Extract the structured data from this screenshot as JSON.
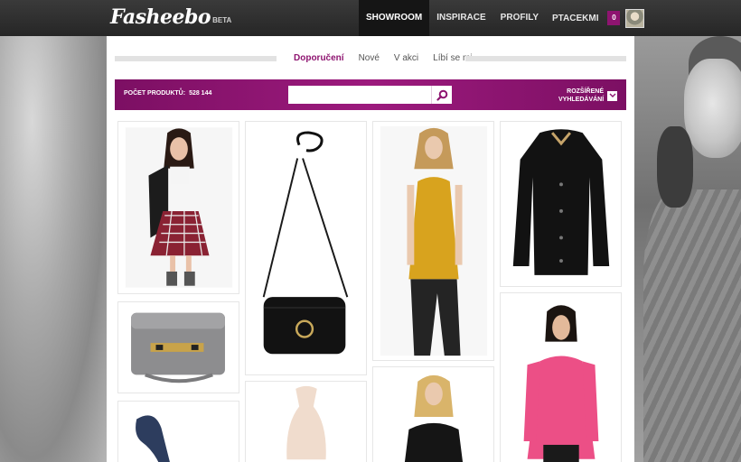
{
  "header": {
    "logo": "Fasheebo",
    "beta": "BETA",
    "nav": [
      "SHOWROOM",
      "INSPIRACE",
      "PROFILY"
    ],
    "active_nav": "SHOWROOM",
    "username": "PTACEKMI",
    "badge_count": "0"
  },
  "tabs": {
    "items": [
      "Doporučení",
      "Nové",
      "V akci",
      "Líbí se mi"
    ],
    "active": "Doporučení"
  },
  "search": {
    "count_label": "POČET PRODUKTŮ:",
    "count_value": "528 144",
    "placeholder": "",
    "advanced_label_1": "ROZŠÍŘENÉ",
    "advanced_label_2": "VYHLEDÁVÁNÍ"
  },
  "products": [
    {
      "name": "plaid skirt outfit with leather jacket",
      "column": 1
    },
    {
      "name": "grey leather satchel bag",
      "column": 1
    },
    {
      "name": "navy suede pump",
      "column": 1
    },
    {
      "name": "black crossbody bag with gold logo",
      "column": 2
    },
    {
      "name": "cream halter top",
      "column": 2
    },
    {
      "name": "mustard tank top with black jeans",
      "column": 3
    },
    {
      "name": "black lace top",
      "column": 3
    },
    {
      "name": "black quilted jacket",
      "column": 4
    },
    {
      "name": "pink blouse",
      "column": 4
    }
  ],
  "colors": {
    "accent": "#8e1470",
    "topbar": "#2b2b2b",
    "background": "#ffffff"
  }
}
